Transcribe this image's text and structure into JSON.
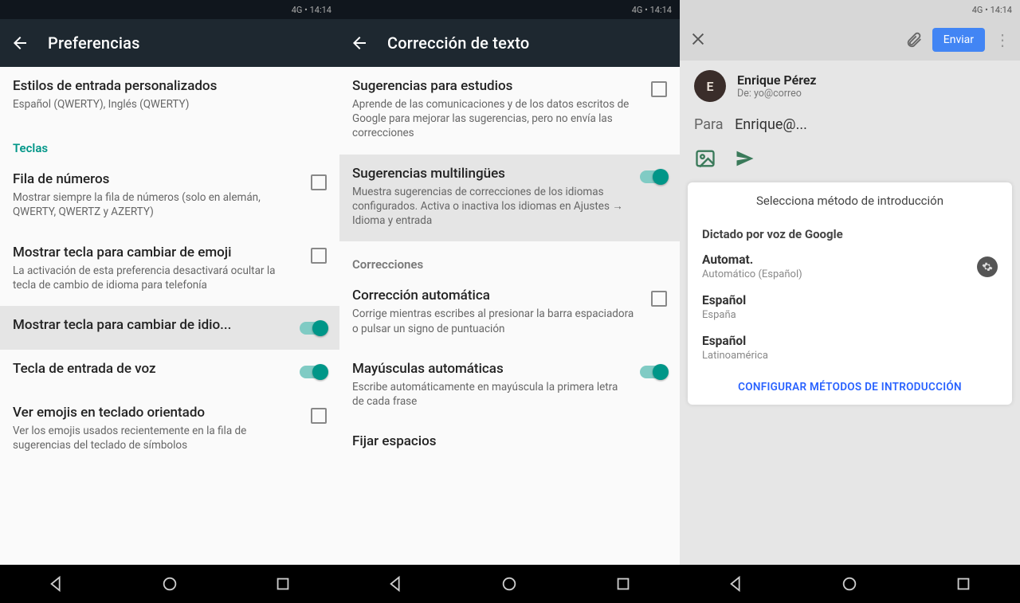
{
  "status": {
    "left": "",
    "right": "4G  •  14:14"
  },
  "col1": {
    "title": "Preferencias",
    "sections": [
      {
        "type": "item",
        "ttl": "Estilos de entrada personalizados",
        "sub": "Español (QWERTY), Inglés (QWERTY)"
      },
      {
        "type": "header",
        "label": "Teclas"
      },
      {
        "type": "check",
        "ttl": "Fila de números",
        "sub": "Mostrar siempre la fila de números (solo en alemán, QWERTY, QWERTZ y AZERTY)",
        "on": false
      },
      {
        "type": "check",
        "ttl": "Mostrar tecla para cambiar de emoji",
        "sub": "La activación de esta preferencia desactivará ocultar la tecla de cambio de idioma para telefonía",
        "on": false
      },
      {
        "type": "switch",
        "ttl": "Mostrar tecla para cambiar de idio...",
        "on": true
      },
      {
        "type": "switch",
        "ttl": "Tecla de entrada de voz",
        "on": true
      },
      {
        "type": "check",
        "ttl": "Ver emojis en teclado orientado",
        "sub": "Ver los emojis usados recientemente en la fila de sugerencias del teclado de símbolos",
        "on": false
      }
    ]
  },
  "col2": {
    "title": "Corrección de texto",
    "items": [
      {
        "type": "check",
        "ttl": "Sugerencias para estudios",
        "sub": "Aprende de las comunicaciones y de los datos escritos de Google para mejorar las sugerencias, pero no envía las correcciones",
        "on": false
      },
      {
        "type": "switch",
        "hl": true,
        "ttl": "Sugerencias multilingües",
        "sub": "Muestra sugerencias de correcciones de los idiomas configurados. Activa o inactiva los idiomas en Ajustes → Idioma y entrada",
        "on": true
      },
      {
        "type": "header",
        "label": "Correcciones"
      },
      {
        "type": "check",
        "ttl": "Corrección automática",
        "sub": "Corrige mientras escribes al presionar la barra espaciadora o pulsar un signo de puntuación",
        "on": false
      },
      {
        "type": "switch",
        "ttl": "Mayúsculas automáticas",
        "sub": "Escribe automáticamente en mayúscula la primera letra de cada frase",
        "on": true
      },
      {
        "type": "plain",
        "ttl": "Fijar espacios"
      }
    ]
  },
  "col3": {
    "bar": {
      "send": "Enviar"
    },
    "from": {
      "name": "Enrique Pérez",
      "addr": "De: yo@correo"
    },
    "to": {
      "label": "Para",
      "value": "Enrique@..."
    },
    "panel": {
      "hdr": "Selecciona método de introducción",
      "sec": "Dictado por voz de Google",
      "opts": [
        {
          "ol": "Automat.",
          "os": "Automático (Español)"
        },
        {
          "ol": "Español",
          "os": "España"
        },
        {
          "ol": "Español",
          "os": "Latinoamérica"
        }
      ],
      "link": "Configurar métodos de introducción"
    }
  },
  "nav": {
    "a": "◁",
    "b": "○",
    "c": "□"
  }
}
